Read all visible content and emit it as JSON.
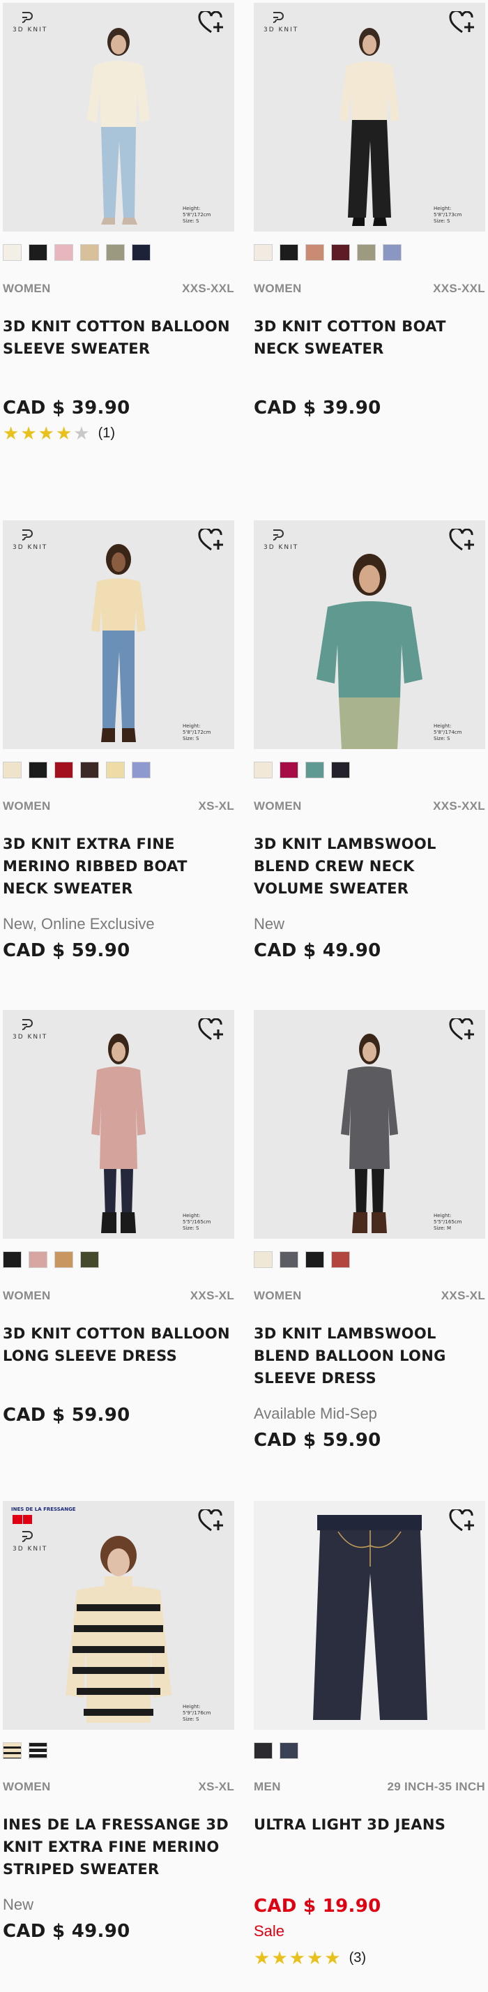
{
  "colors": {
    "background": "#fafafa",
    "text": "#1b1b1b",
    "muted": "#8a8a8a",
    "sale_red": "#e00012",
    "star_gold": "#e8c11c"
  },
  "brand_tag": "3D KNIT",
  "products": [
    {
      "name": "3D KNIT COTTON BALLOON SLEEVE SWEATER",
      "gender": "WOMEN",
      "size_range": "XXS-XXL",
      "price": "CAD $ 39.90",
      "rating_stars": 4,
      "rating_count": "(1)",
      "model_spec": "Height: 5'8\"/172cm\nSize: S",
      "swatches": [
        "#f4efe6",
        "#1c1c1c",
        "#e8b6bd",
        "#d8c19a",
        "#9b9a80",
        "#1d2238"
      ]
    },
    {
      "name": "3D KNIT COTTON BOAT NECK SWEATER",
      "gender": "WOMEN",
      "size_range": "XXS-XXL",
      "price": "CAD $ 39.90",
      "model_spec": "Height: 5'8\"/173cm\nSize: S",
      "swatches": [
        "#f1ebe1",
        "#1c1c1c",
        "#c98c72",
        "#5c1d27",
        "#9d9a80",
        "#8a97c2"
      ]
    },
    {
      "name": "3D KNIT EXTRA FINE MERINO RIBBED BOAT NECK SWEATER",
      "gender": "WOMEN",
      "size_range": "XS-XL",
      "flag": "New, Online Exclusive",
      "price": "CAD $ 59.90",
      "model_spec": "Height: 5'8\"/172cm\nSize: S",
      "swatches": [
        "#efe3cb",
        "#1c1c1c",
        "#a3111f",
        "#3c2a26",
        "#eedca6",
        "#8e99cf"
      ]
    },
    {
      "name": "3D KNIT LAMBSWOOL BLEND CREW NECK VOLUME SWEATER",
      "gender": "WOMEN",
      "size_range": "XXS-XXL",
      "flag": "New",
      "price": "CAD $ 49.90",
      "model_spec": "Height: 5'8\"/174cm\nSize: S",
      "swatches": [
        "#f1e8d7",
        "#a60d46",
        "#5e9a92",
        "#24212a"
      ]
    },
    {
      "name": "3D KNIT COTTON BALLOON LONG SLEEVE DRESS",
      "gender": "WOMEN",
      "size_range": "XXS-XL",
      "price": "CAD $ 59.90",
      "model_spec": "Height: 5'5\"/165cm\nSize: S",
      "swatches": [
        "#1c1c1c",
        "#d8a6a2",
        "#c99560",
        "#454a2c"
      ]
    },
    {
      "name": "3D KNIT LAMBSWOOL BLEND BALLOON LONG SLEEVE DRESS",
      "gender": "WOMEN",
      "size_range": "XXS-XL",
      "flag": "Available Mid-Sep",
      "price": "CAD $ 59.90",
      "model_spec": "Height: 5'5\"/165cm\nSize: M",
      "swatches": [
        "#f0e8d6",
        "#5c5c64",
        "#1c1c1c",
        "#b3473f"
      ]
    },
    {
      "name": "INES DE LA FRESSANGE 3D KNIT EXTRA FINE MERINO STRIPED SWEATER",
      "gender": "WOMEN",
      "size_range": "XS-XL",
      "flag": "New",
      "price": "CAD $ 49.90",
      "model_spec": "Height: 5'9\"/176cm\nSize: S",
      "collab_label": "INES DE LA FRESSANGE",
      "swatches": [
        "stripe-beige",
        "stripe-black"
      ]
    },
    {
      "name": "ULTRA LIGHT 3D JEANS",
      "gender": "MEN",
      "size_range": "29 INCH-35 INCH",
      "price": "CAD $ 19.90",
      "sale_label": "Sale",
      "rating_stars": 5,
      "rating_count": "(3)",
      "swatches": [
        "#2b2a2e",
        "#3b4154"
      ]
    }
  ]
}
